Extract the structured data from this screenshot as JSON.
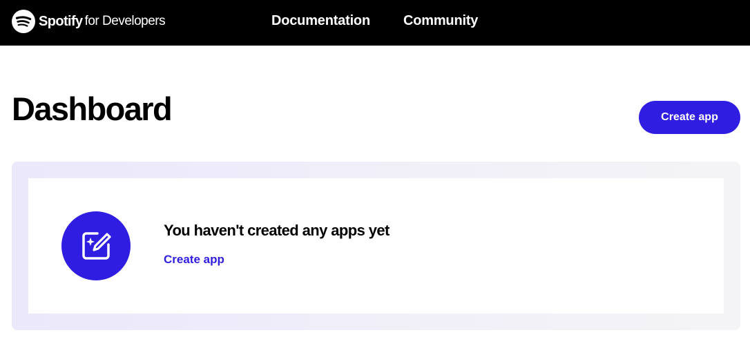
{
  "brand": {
    "logo_icon": "spotify-logo-icon",
    "name": "Spotify",
    "suffix": "for Developers"
  },
  "nav": {
    "items": [
      {
        "label": "Documentation"
      },
      {
        "label": "Community"
      }
    ]
  },
  "main": {
    "title": "Dashboard",
    "create_button_label": "Create app"
  },
  "empty_state": {
    "icon": "edit-sparkle-icon",
    "title": "You haven't created any apps yet",
    "link_label": "Create app"
  },
  "colors": {
    "topbar": "#000000",
    "accent": "#2f1de2",
    "panel_bg": "#ebe8fb"
  }
}
